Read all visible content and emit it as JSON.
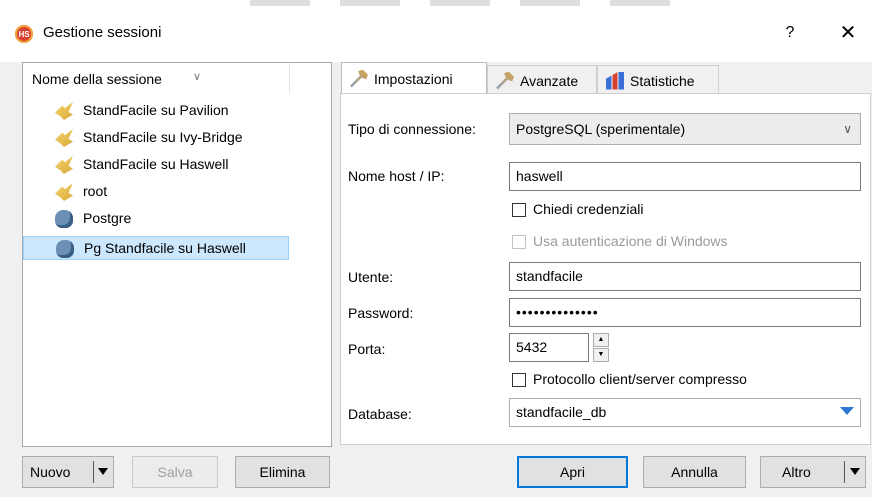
{
  "window": {
    "title": "Gestione sessioni",
    "app_icon_text": "HS",
    "help_label": "?",
    "close_label": "✕"
  },
  "session_list": {
    "header": "Nome della sessione",
    "sort_icon": "chevron-down-icon",
    "items": [
      {
        "label": "StandFacile su Pavilion",
        "icon": "database-wizard-icon",
        "selected": false
      },
      {
        "label": "StandFacile su Ivy-Bridge",
        "icon": "database-wizard-icon",
        "selected": false
      },
      {
        "label": "StandFacile su Haswell",
        "icon": "database-wizard-icon",
        "selected": false
      },
      {
        "label": "root",
        "icon": "database-wizard-icon",
        "selected": false
      },
      {
        "label": "Postgre",
        "icon": "postgres-elephant-icon",
        "selected": false
      },
      {
        "label": "Pg Standfacile su Haswell",
        "icon": "postgres-elephant-icon",
        "selected": true
      }
    ]
  },
  "tabs": [
    {
      "label": "Impostazioni",
      "icon": "wrench-icon",
      "active": true
    },
    {
      "label": "Avanzate",
      "icon": "wrench-icon",
      "active": false
    },
    {
      "label": "Statistiche",
      "icon": "bar-chart-icon",
      "active": false
    }
  ],
  "settings": {
    "connection_type_label": "Tipo di connessione:",
    "connection_type_value": "PostgreSQL (sperimentale)",
    "host_label": "Nome host / IP:",
    "host_value": "haswell",
    "ask_credentials_label": "Chiedi credenziali",
    "ask_credentials_checked": false,
    "windows_auth_label": "Usa autenticazione di Windows",
    "windows_auth_checked": false,
    "user_label": "Utente:",
    "user_value": "standfacile",
    "password_label": "Password:",
    "password_value": "••••••••••••••",
    "port_label": "Porta:",
    "port_value": "5432",
    "compressed_label": "Protocollo client/server compresso",
    "compressed_checked": false,
    "database_label": "Database:",
    "database_value": "standfacile_db"
  },
  "buttons": {
    "new": "Nuovo",
    "save": "Salva",
    "delete": "Elimina",
    "open": "Apri",
    "cancel": "Annulla",
    "more": "Altro"
  },
  "colors": {
    "selection": "#cce8ff",
    "primary_border": "#0078d7",
    "dropdown_arrow": "#2f77d4"
  }
}
